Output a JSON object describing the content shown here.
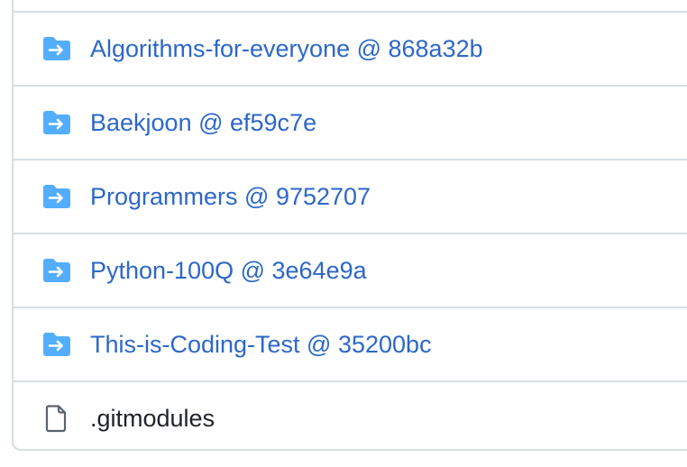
{
  "files": [
    {
      "name": "Algorithms-for-everyone @ 868a32b",
      "kind": "submodule",
      "icon": "submodule-folder-icon"
    },
    {
      "name": "Baekjoon @ ef59c7e",
      "kind": "submodule",
      "icon": "submodule-folder-icon"
    },
    {
      "name": "Programmers @ 9752707",
      "kind": "submodule",
      "icon": "submodule-folder-icon"
    },
    {
      "name": "Python-100Q @ 3e64e9a",
      "kind": "submodule",
      "icon": "submodule-folder-icon"
    },
    {
      "name": "This-is-Coding-Test @ 35200bc",
      "kind": "submodule",
      "icon": "submodule-folder-icon"
    },
    {
      "name": ".gitmodules",
      "kind": "file",
      "icon": "file-icon"
    }
  ],
  "colors": {
    "link": "#2c67c9",
    "folder": "#54aeff",
    "border": "#d8dee4",
    "text": "#1f2328"
  }
}
